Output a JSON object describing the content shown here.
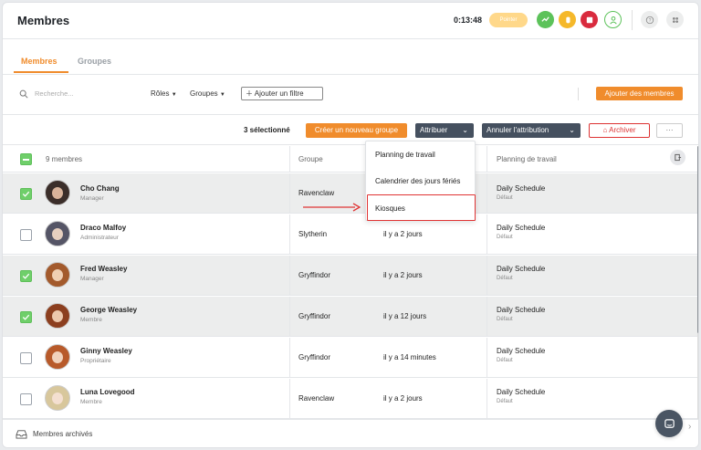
{
  "header": {
    "title": "Membres",
    "timer": "0:13:48",
    "status_pill": "Pointer"
  },
  "tabs": [
    {
      "label": "Membres",
      "active": true
    },
    {
      "label": "Groupes",
      "active": false
    }
  ],
  "filters": {
    "search_placeholder": "Recherche...",
    "roles_label": "Rôles",
    "groupes_label": "Groupes",
    "add_filter_label": "Ajouter un filtre",
    "add_members_label": "Ajouter des membres"
  },
  "actions": {
    "selected_count": "3 sélectionné",
    "create_group_label": "Créer un nouveau groupe",
    "assign_label": "Attribuer",
    "unassign_label": "Annuler l'attribution",
    "archive_label": "Archiver",
    "more_label": "···"
  },
  "table": {
    "member_count_header": "9 membres",
    "col_group": "Groupe",
    "col_schedule": "Planning de travail",
    "rows": [
      {
        "name": "Cho Chang",
        "role": "Manager",
        "group": "Ravenclaw",
        "time": "",
        "schedule": "Daily Schedule",
        "schedule_sub": "Défaut",
        "selected": true
      },
      {
        "name": "Draco Malfoy",
        "role": "Administrateur",
        "group": "Slytherin",
        "time": "il y a 2 jours",
        "schedule": "Daily Schedule",
        "schedule_sub": "Défaut",
        "selected": false
      },
      {
        "name": "Fred Weasley",
        "role": "Manager",
        "group": "Gryffindor",
        "time": "il y a 2 jours",
        "schedule": "Daily Schedule",
        "schedule_sub": "Défaut",
        "selected": true
      },
      {
        "name": "George Weasley",
        "role": "Membre",
        "group": "Gryffindor",
        "time": "il y a 12 jours",
        "schedule": "Daily Schedule",
        "schedule_sub": "Défaut",
        "selected": true
      },
      {
        "name": "Ginny Weasley",
        "role": "Propriétaire",
        "group": "Gryffindor",
        "time": "il y a 14 minutes",
        "schedule": "Daily Schedule",
        "schedule_sub": "Défaut",
        "selected": false
      },
      {
        "name": "Luna Lovegood",
        "role": "Membre",
        "group": "Ravenclaw",
        "time": "il y a 2 jours",
        "schedule": "Daily Schedule",
        "schedule_sub": "Défaut",
        "selected": false
      }
    ]
  },
  "dropdown": {
    "items": [
      "Planning de travail",
      "Calendrier des jours fériés",
      "Kiosques"
    ]
  },
  "footer": {
    "archived_label": "Membres archivés"
  },
  "colors": {
    "accent": "#f08c2c",
    "dark_button": "#45505f",
    "check_green": "#6fcf6a",
    "highlight_red": "#e03434"
  }
}
